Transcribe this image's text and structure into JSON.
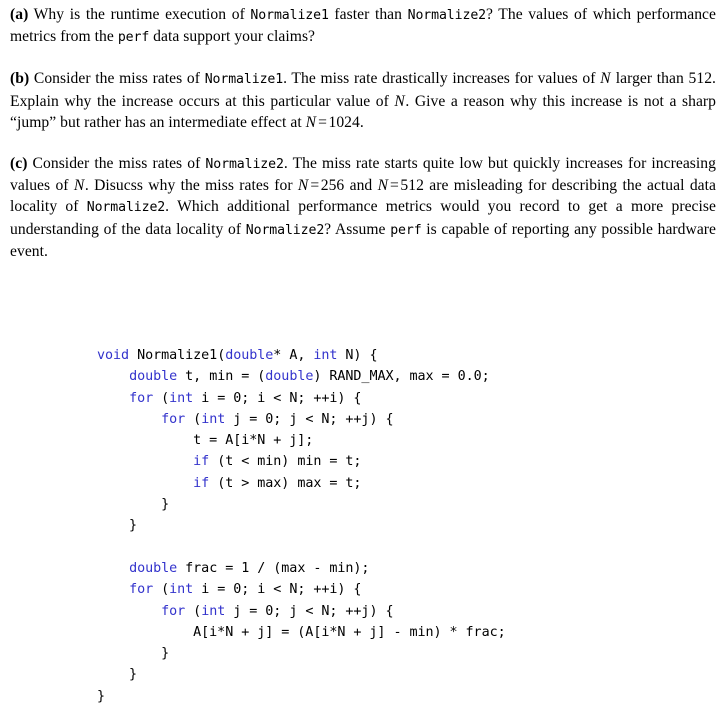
{
  "document": {
    "questions": [
      {
        "label": "(a)",
        "id": "question-a",
        "parts": [
          {
            "type": "text",
            "text": " Why is the runtime execution of "
          },
          {
            "type": "tt",
            "text": "Normalize1"
          },
          {
            "type": "text",
            "text": " faster than "
          },
          {
            "type": "tt",
            "text": "Normalize2"
          },
          {
            "type": "text",
            "text": "?  The values of which performance metrics from the "
          },
          {
            "type": "tt",
            "text": "perf"
          },
          {
            "type": "text",
            "text": " data support your claims?"
          }
        ],
        "plain": "(a) Why is the runtime execution of Normalize1 faster than Normalize2? The values of which performance metrics from the perf data support your claims?"
      },
      {
        "label": "(b)",
        "id": "question-b",
        "parts": [
          {
            "type": "text",
            "text": " Consider the miss rates of "
          },
          {
            "type": "tt",
            "text": "Normalize1"
          },
          {
            "type": "text",
            "text": ".  The miss rate drastically increases for values of "
          },
          {
            "type": "math",
            "text": "N"
          },
          {
            "type": "text",
            "text": " larger than 512.  Explain why the increase occurs at this particular value of "
          },
          {
            "type": "math",
            "text": "N"
          },
          {
            "type": "text",
            "text": ".  Give a reason why this increase is not a sharp “jump” but rather has an intermediate effect at "
          },
          {
            "type": "math",
            "text": "N"
          },
          {
            "type": "eq",
            "text": "="
          },
          {
            "type": "num",
            "text": "1024"
          },
          {
            "type": "text",
            "text": "."
          }
        ],
        "plain": "(b) Consider the miss rates of Normalize1. The miss rate drastically increases for values of N larger than 512. Explain why the increase occurs at this particular value of N. Give a reason why this increase is not a sharp “jump” but rather has an intermediate effect at N = 1024."
      },
      {
        "label": "(c)",
        "id": "question-c",
        "parts": [
          {
            "type": "text",
            "text": " Consider the miss rates of "
          },
          {
            "type": "tt",
            "text": "Normalize2"
          },
          {
            "type": "text",
            "text": ".  The miss rate starts quite low but quickly increases for increasing values of "
          },
          {
            "type": "math",
            "text": "N"
          },
          {
            "type": "text",
            "text": ".  Disucss why the miss rates for "
          },
          {
            "type": "math",
            "text": "N"
          },
          {
            "type": "eq",
            "text": "="
          },
          {
            "type": "num",
            "text": "256"
          },
          {
            "type": "text",
            "text": " and "
          },
          {
            "type": "math",
            "text": "N"
          },
          {
            "type": "eq",
            "text": "="
          },
          {
            "type": "num",
            "text": "512"
          },
          {
            "type": "text",
            "text": " are misleading for describing the actual data locality of "
          },
          {
            "type": "tt",
            "text": "Normalize2"
          },
          {
            "type": "text",
            "text": ".  Which additional performance metrics would you record to get a more precise understanding of the data locality of "
          },
          {
            "type": "tt",
            "text": "Normalize2"
          },
          {
            "type": "text",
            "text": "?  Assume "
          },
          {
            "type": "tt",
            "text": "perf"
          },
          {
            "type": "text",
            "text": " is capable of reporting any possible hardware event."
          }
        ],
        "plain": "(c) Consider the miss rates of Normalize2. The miss rate starts quite low but quickly increases for increasing values of N. Disucss why the miss rates for N = 256 and N = 512 are misleading for describing the actual data locality of Normalize2. Which additional performance metrics would you record to get a more precise understanding of the data locality of Normalize2? Assume perf is capable of reporting any possible hardware event."
      }
    ],
    "code_listing": {
      "language": "C",
      "function_name": "Normalize1",
      "keyword_color": "#3333cc",
      "text_color": "#000000",
      "lines": [
        [
          {
            "t": "kw",
            "s": "void"
          },
          {
            "t": "p",
            "s": " Normalize1("
          },
          {
            "t": "kw",
            "s": "double"
          },
          {
            "t": "p",
            "s": "* A, "
          },
          {
            "t": "kw",
            "s": "int"
          },
          {
            "t": "p",
            "s": " N) {"
          }
        ],
        [
          {
            "t": "p",
            "s": "    "
          },
          {
            "t": "kw",
            "s": "double"
          },
          {
            "t": "p",
            "s": " t, min = ("
          },
          {
            "t": "kw",
            "s": "double"
          },
          {
            "t": "p",
            "s": ") RAND_MAX, max = 0.0;"
          }
        ],
        [
          {
            "t": "p",
            "s": "    "
          },
          {
            "t": "kw",
            "s": "for"
          },
          {
            "t": "p",
            "s": " ("
          },
          {
            "t": "kw",
            "s": "int"
          },
          {
            "t": "p",
            "s": " i = 0; i < N; ++i) {"
          }
        ],
        [
          {
            "t": "p",
            "s": "        "
          },
          {
            "t": "kw",
            "s": "for"
          },
          {
            "t": "p",
            "s": " ("
          },
          {
            "t": "kw",
            "s": "int"
          },
          {
            "t": "p",
            "s": " j = 0; j < N; ++j) {"
          }
        ],
        [
          {
            "t": "p",
            "s": "            t = A[i*N + j];"
          }
        ],
        [
          {
            "t": "p",
            "s": "            "
          },
          {
            "t": "kw",
            "s": "if"
          },
          {
            "t": "p",
            "s": " (t < min) min = t;"
          }
        ],
        [
          {
            "t": "p",
            "s": "            "
          },
          {
            "t": "kw",
            "s": "if"
          },
          {
            "t": "p",
            "s": " (t > max) max = t;"
          }
        ],
        [
          {
            "t": "p",
            "s": "        }"
          }
        ],
        [
          {
            "t": "p",
            "s": "    }"
          }
        ],
        [],
        [
          {
            "t": "p",
            "s": "    "
          },
          {
            "t": "kw",
            "s": "double"
          },
          {
            "t": "p",
            "s": " frac = 1 / (max - min);"
          }
        ],
        [
          {
            "t": "p",
            "s": "    "
          },
          {
            "t": "kw",
            "s": "for"
          },
          {
            "t": "p",
            "s": " ("
          },
          {
            "t": "kw",
            "s": "int"
          },
          {
            "t": "p",
            "s": " i = 0; i < N; ++i) {"
          }
        ],
        [
          {
            "t": "p",
            "s": "        "
          },
          {
            "t": "kw",
            "s": "for"
          },
          {
            "t": "p",
            "s": " ("
          },
          {
            "t": "kw",
            "s": "int"
          },
          {
            "t": "p",
            "s": " j = 0; j < N; ++j) {"
          }
        ],
        [
          {
            "t": "p",
            "s": "            A[i*N + j] = (A[i*N + j] - min) * frac;"
          }
        ],
        [
          {
            "t": "p",
            "s": "        }"
          }
        ],
        [
          {
            "t": "p",
            "s": "    }"
          }
        ],
        [
          {
            "t": "p",
            "s": "}"
          }
        ]
      ]
    }
  }
}
